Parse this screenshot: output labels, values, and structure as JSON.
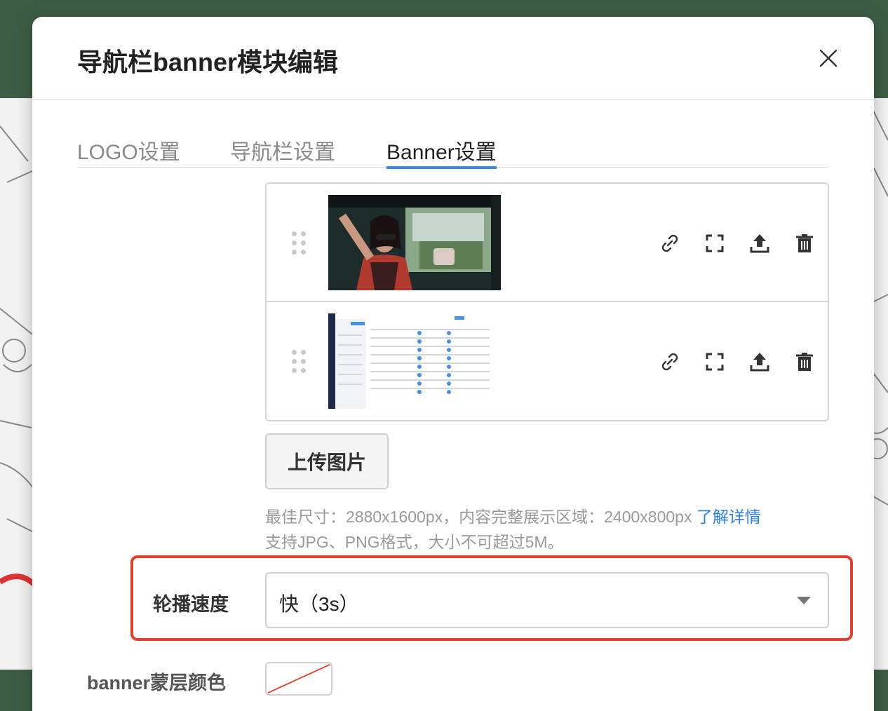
{
  "modal": {
    "title": "导航栏banner模块编辑"
  },
  "tabs": [
    {
      "label": "LOGO设置",
      "active": false
    },
    {
      "label": "导航栏设置",
      "active": false
    },
    {
      "label": "Banner设置",
      "active": true
    }
  ],
  "banners": [
    {
      "thumb": "photo-woman-in-car"
    },
    {
      "thumb": "screenshot-dashboard"
    }
  ],
  "row_actions": [
    "link-icon",
    "fullscreen-icon",
    "upload-icon",
    "trash-icon"
  ],
  "upload": {
    "button_label": "上传图片",
    "hint_line1": "最佳尺寸：2880x1600px，内容完整展示区域：2400x800px ",
    "hint_link": "了解详情",
    "hint_line2": "支持JPG、PNG格式，大小不可超过5M。"
  },
  "speed": {
    "label": "轮播速度",
    "value": "快（3s）"
  },
  "mask": {
    "label": "banner蒙层颜色"
  },
  "colors": {
    "accent": "#3b86e6",
    "highlight": "#e1402c",
    "link": "#2f7fe6"
  }
}
